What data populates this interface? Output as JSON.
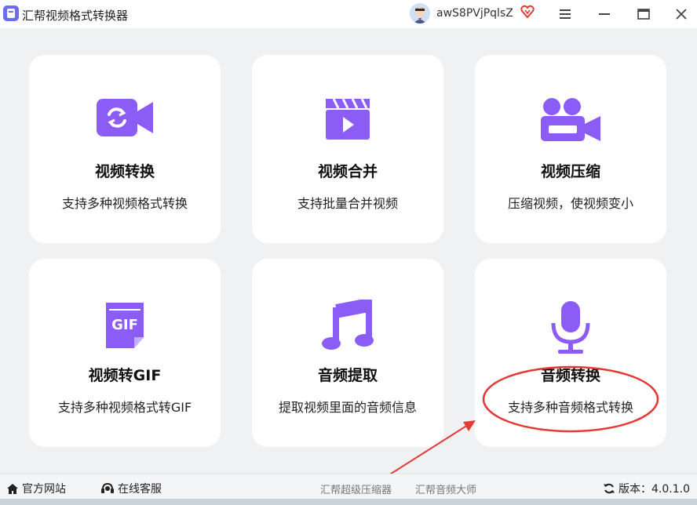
{
  "window": {
    "title": "汇帮视频格式转换器",
    "username": "awS8PVjPqlsZ",
    "icons": [
      "app-icon",
      "avatar",
      "vip-heart-icon",
      "menu-icon",
      "minimize-icon",
      "maximize-icon",
      "close-icon"
    ]
  },
  "colors": {
    "accent": "#8b5cf6",
    "annotation": "#e53935"
  },
  "cards": [
    {
      "title": "视频转换",
      "desc": "支持多种视频格式转换",
      "icon": "video-convert-icon"
    },
    {
      "title": "视频合并",
      "desc": "支持批量合并视频",
      "icon": "clapperboard-icon"
    },
    {
      "title": "视频压缩",
      "desc": "压缩视频，使视频变小",
      "icon": "video-camera-icon"
    },
    {
      "title": "视频转GIF",
      "desc": "支持多种视频格式转GIF",
      "icon": "gif-file-icon"
    },
    {
      "title": "音频提取",
      "desc": "提取视频里面的音频信息",
      "icon": "music-note-icon"
    },
    {
      "title": "音频转换",
      "desc": "支持多种音频格式转换",
      "icon": "microphone-icon"
    }
  ],
  "footer": {
    "website": "官方网站",
    "service": "在线客服",
    "link1": "汇帮超级压缩器",
    "link2": "汇帮音频大师",
    "version": "版本：4.0.1.0"
  }
}
